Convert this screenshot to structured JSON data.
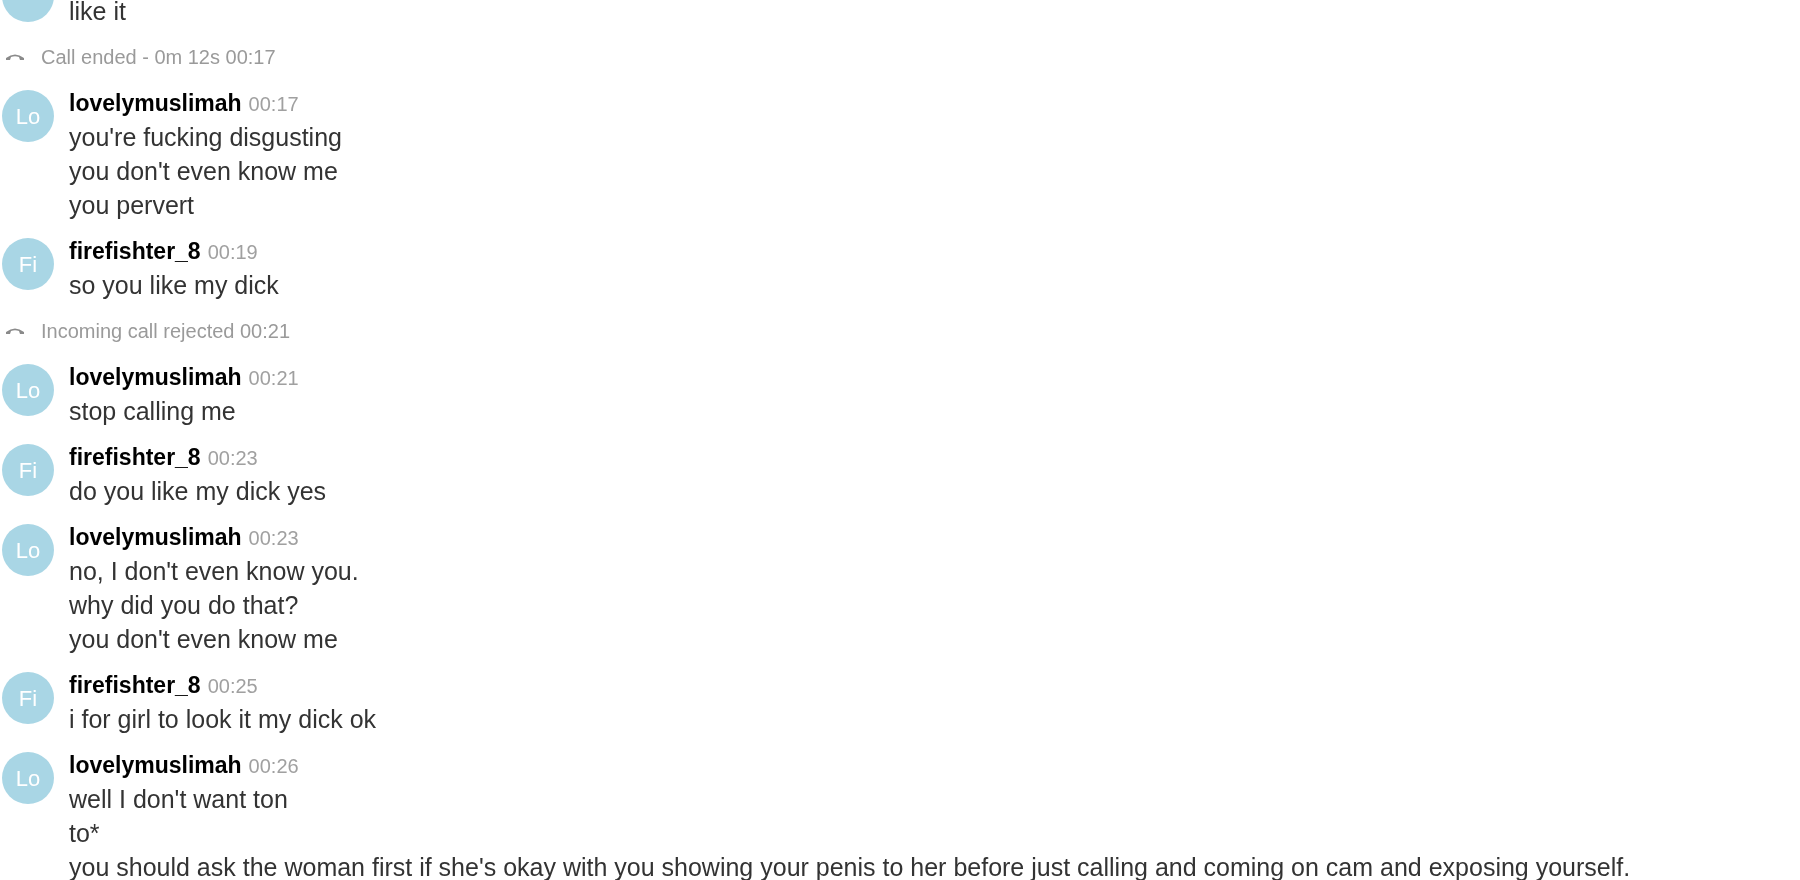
{
  "messages": [
    {
      "kind": "fragment",
      "lines": [
        "like it"
      ]
    },
    {
      "kind": "call",
      "text": "Call ended - 0m 12s 00:17"
    },
    {
      "kind": "message",
      "initials": "Lo",
      "author": "lovelymuslimah",
      "time": "00:17",
      "lines": [
        "you're fucking disgusting",
        "you don't even know me",
        "you pervert"
      ]
    },
    {
      "kind": "message",
      "initials": "Fi",
      "author": "firefishter_8",
      "time": "00:19",
      "lines": [
        "so you like my dick"
      ]
    },
    {
      "kind": "call",
      "text": "Incoming call rejected 00:21"
    },
    {
      "kind": "message",
      "initials": "Lo",
      "author": "lovelymuslimah",
      "time": "00:21",
      "lines": [
        "stop calling me"
      ]
    },
    {
      "kind": "message",
      "initials": "Fi",
      "author": "firefishter_8",
      "time": "00:23",
      "lines": [
        "do you like my dick yes"
      ]
    },
    {
      "kind": "message",
      "initials": "Lo",
      "author": "lovelymuslimah",
      "time": "00:23",
      "lines": [
        "no, I don't even know you.",
        "why did you do that?",
        "you don't even know me"
      ]
    },
    {
      "kind": "message",
      "initials": "Fi",
      "author": "firefishter_8",
      "time": "00:25",
      "lines": [
        "i for girl to look it my dick ok"
      ]
    },
    {
      "kind": "message",
      "initials": "Lo",
      "author": "lovelymuslimah",
      "time": "00:26",
      "lines": [
        "well I don't want ton",
        "to*",
        "you should ask the woman first if she's okay with you showing your penis to her before just calling and coming on cam and exposing yourself."
      ]
    }
  ]
}
